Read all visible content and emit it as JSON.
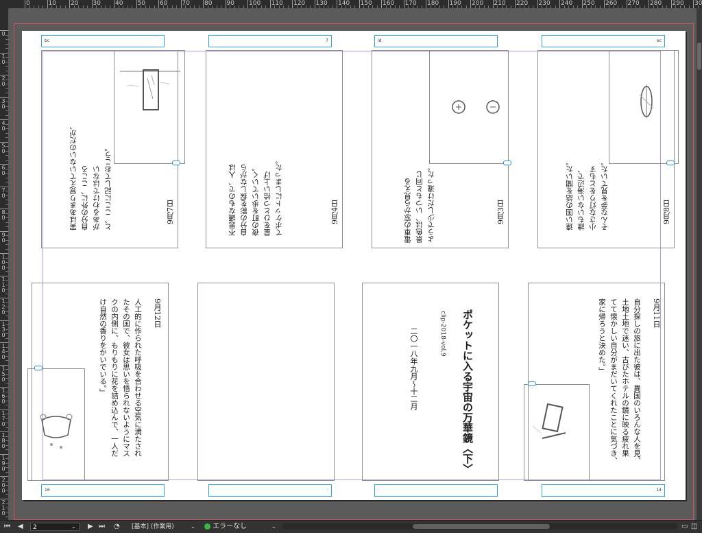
{
  "ruler": {
    "top_labels": [
      "0",
      "10",
      "20",
      "30",
      "40",
      "50",
      "60",
      "70",
      "80",
      "90",
      "100",
      "110",
      "120",
      "130",
      "140",
      "150",
      "160",
      "170",
      "180",
      "190",
      "200",
      "210",
      "220",
      "230",
      "240",
      "250",
      "260",
      "270",
      "280",
      "290",
      "30"
    ],
    "left_labels": [
      "0",
      "10",
      "20",
      "30",
      "40",
      "50",
      "60",
      "70",
      "80",
      "90",
      "100",
      "110",
      "120",
      "130",
      "140",
      "150",
      "160",
      "170",
      "180",
      "190",
      "200",
      "210"
    ]
  },
  "spreads": {
    "top": [
      {
        "date": "9月7日",
        "text": "実はあまり覚えていないのだが、\n自分の外に、こころ\nがあるわけではない\nと、ここに記しておこう。",
        "num": "bc"
      },
      {
        "date": "9月4日",
        "text": "不思議なもので、人は\n自分の影を探しながら\n夜の町を歩いていく。\n星をひとつ拾い上げ\nてポケットにしまった。",
        "num": "7"
      },
      {
        "date": "9月3日",
        "text": "電車の窓から見える\n景色は、いつもと同じ\nようで少しだけ違った。",
        "num": "ld"
      },
      {
        "date": "9月8日",
        "text": "遠い国の話を聞いた。\n誰もいない海辺で、\n小さな灯りをともす\nそんな夢を見ていた。",
        "num": "ec"
      }
    ],
    "bottom": {
      "p12": {
        "date": "9月12日",
        "text": "人工的に作られた呼吸を合わせる空気に満たされ\nたその国で、彼女は思いを悟られないようにマス\nクの内側に、もりもりに花を詰め込んで、一人だ\nけ自然の香りをかいでいる。」",
        "num": "16"
      },
      "title": {
        "main": "ポケットに入る宇宙の万華鏡〈下〉",
        "sub": "clip-2018-vol.9",
        "period": "二〇一八年九月〜十二月"
      },
      "p11": {
        "date": "9月11日",
        "text": "自分探しの旅に出た彼は、異国のいろんな人を見、\n土地土地で迷い、古びたホテルの鏡に映る疲れ果\nてて懐かしい自分がまだいてくれたことに気づき、\n家に帰ろうと決めた。」",
        "num": "14"
      }
    }
  },
  "statusbar": {
    "page_value": "2",
    "layer_label": "[基本] (作業用)",
    "error_label": "エラーなし",
    "error_color": "#39b54a"
  },
  "colors": {
    "bleed": "#d3525f",
    "margin_guide": "#b49ad6",
    "pagenum_frame": "#2ea0dc",
    "page": "#ffffff",
    "pasteboard": "#5b5b5b"
  }
}
